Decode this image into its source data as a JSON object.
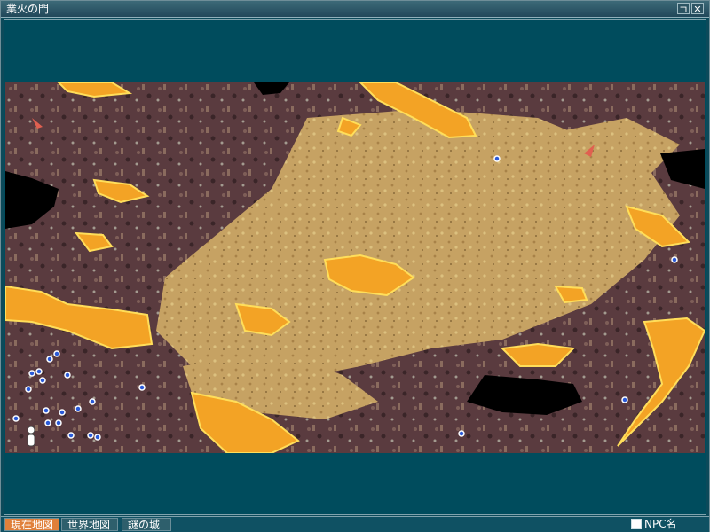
{
  "window": {
    "title": "業火の門",
    "pin_label": "⊐",
    "close_label": "✕"
  },
  "tabs": [
    {
      "label": "現在地図",
      "active": true
    },
    {
      "label": "世界地図",
      "active": false
    },
    {
      "label": "謎の城",
      "active": false
    }
  ],
  "legend": {
    "npc_label": "NPC名"
  },
  "colors": {
    "lava": "#f5a623",
    "rock": "#5a3b3f",
    "sand": "#c9a765",
    "void": "#000000",
    "frame": "#004c5d",
    "marker": "#2a5ad8",
    "active_tab": "#e0803a"
  },
  "map": {
    "npc_markers_count": 22
  }
}
